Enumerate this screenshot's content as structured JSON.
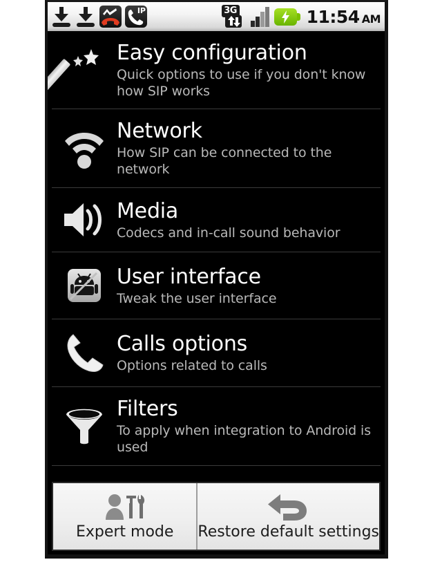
{
  "statusbar": {
    "left_icons": [
      {
        "name": "download-icon-1",
        "icon": "download-arrow"
      },
      {
        "name": "download-icon-2",
        "icon": "download-arrow"
      },
      {
        "name": "missed-call-icon",
        "icon": "missed-call"
      },
      {
        "name": "ip-call-icon",
        "icon": "ip-call",
        "label": "IP"
      }
    ],
    "network_type": "3G",
    "right_icons": [
      {
        "name": "data-3g-icon",
        "icon": "3g-data-arrows"
      },
      {
        "name": "signal-strength-icon",
        "icon": "signal-bars"
      },
      {
        "name": "battery-charging-icon",
        "icon": "battery-charging"
      }
    ],
    "time": "11:54",
    "ampm": "AM"
  },
  "list": {
    "items": [
      {
        "icon": "magic-wand-icon",
        "title": "Easy configuration",
        "subtitle": "Quick options to use if you don't know how SIP works"
      },
      {
        "icon": "wifi-signal-icon",
        "title": "Network",
        "subtitle": "How SIP can be connected to the network"
      },
      {
        "icon": "speaker-icon",
        "title": "Media",
        "subtitle": "Codecs and in-call sound behavior"
      },
      {
        "icon": "android-robot-icon",
        "title": "User interface",
        "subtitle": "Tweak the user interface"
      },
      {
        "icon": "phone-handset-icon",
        "title": "Calls options",
        "subtitle": "Options related to calls"
      },
      {
        "icon": "funnel-filter-icon",
        "title": "Filters",
        "subtitle": "To apply when integration to Android is used"
      }
    ]
  },
  "bottombar": {
    "buttons": [
      {
        "icon": "person-tools-icon",
        "label": "Expert mode"
      },
      {
        "icon": "undo-arrow-icon",
        "label": "Restore default settings"
      }
    ]
  },
  "colors": {
    "screen_background": "#000000",
    "title_text": "#ffffff",
    "subtitle_text": "#b9b9b9",
    "divider": "#3b3b3b",
    "battery_green": "#8fd01a",
    "missed_call_red": "#e03b20",
    "bottom_button_background": "#efefef",
    "bottom_button_text": "#1c1c1c"
  }
}
